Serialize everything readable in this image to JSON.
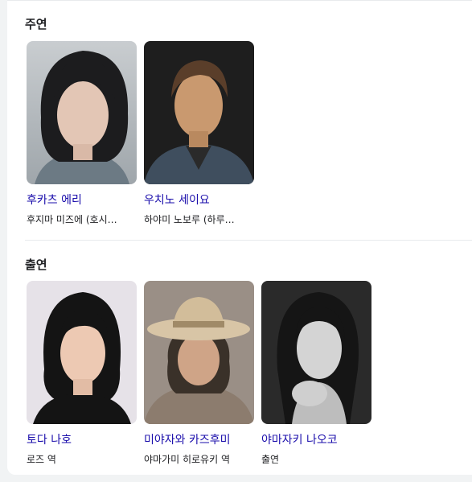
{
  "sections": [
    {
      "title": "주연",
      "people": [
        {
          "name": "후카츠 에리",
          "role": "후지마 미즈에 (호시…"
        },
        {
          "name": "우치노 세이요",
          "role": "하야미 노보루 (하루…"
        }
      ]
    },
    {
      "title": "출연",
      "people": [
        {
          "name": "토다 나호",
          "role": "로즈 역"
        },
        {
          "name": "미야자와 카즈후미",
          "role": "야마가미 히로유키 역"
        },
        {
          "name": "야마자키 나오코",
          "role": "출연"
        }
      ]
    }
  ],
  "colors": {
    "link": "#1a0dab",
    "text": "#202124",
    "background": "#f1f3f4",
    "card": "#ffffff"
  }
}
